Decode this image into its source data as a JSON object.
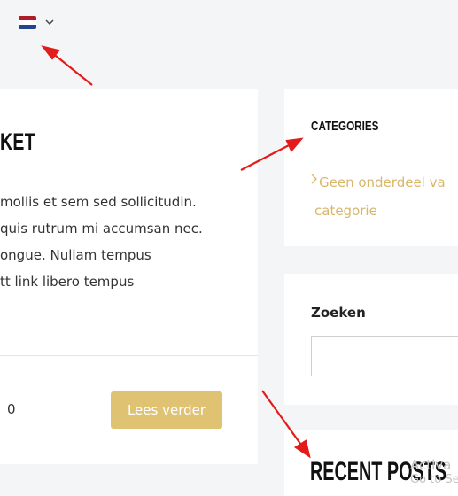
{
  "header": {
    "language_flag": "netherlands-flag-icon",
    "language_dropdown_icon": "chevron-down-icon"
  },
  "post": {
    "title": "KET",
    "excerpt_lines": [
      "mollis et sem sed sollicitudin.",
      "quis rutrum mi accumsan nec.",
      "ongue. Nullam tempus",
      "tt link libero tempus"
    ],
    "comment_count": "0",
    "read_more_label": "Lees verder"
  },
  "sidebar": {
    "categories": {
      "title": "CATEGORIES",
      "items": [
        {
          "label_line1": "Geen onderdeel va",
          "label_line2": "categorie"
        }
      ]
    },
    "search": {
      "label": "Zoeken",
      "value": ""
    },
    "recent_posts": {
      "title": "RECENT POSTS"
    }
  },
  "watermark": {
    "line1": "Activa",
    "line2": "Go to Se"
  },
  "colors": {
    "accent_gold": "#e0c273",
    "link_gold": "#d8b66a",
    "annotation_red": "#e31b1b",
    "background": "#f4f5f7"
  }
}
